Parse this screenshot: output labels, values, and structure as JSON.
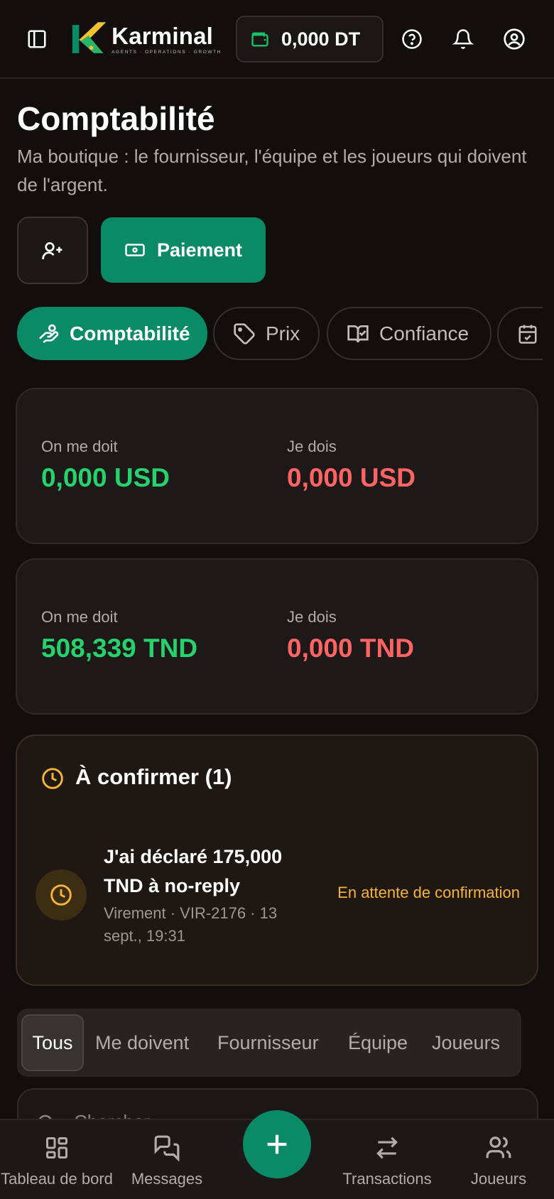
{
  "header": {
    "brand_name": "Karminal",
    "brand_tagline": "AGENTS · OPERATIONS · GROWTH",
    "wallet_amount": "0,000 DT"
  },
  "page": {
    "title": "Comptabilité",
    "subtitle": "Ma boutique : le fournisseur, l'équipe et les joueurs qui doivent de l'argent."
  },
  "actions": {
    "payment_label": "Paiement"
  },
  "tabs": [
    {
      "label": "Comptabilité",
      "icon": "hand-coins-icon",
      "active": true
    },
    {
      "label": "Prix",
      "icon": "tag-icon",
      "active": false
    },
    {
      "label": "Confiance",
      "icon": "book-check-icon",
      "active": false
    },
    {
      "label": "",
      "icon": "calendar-check-icon",
      "active": false
    }
  ],
  "balances": [
    {
      "owed_to_me_label": "On me doit",
      "owed_to_me": "0,000 USD",
      "i_owe_label": "Je dois",
      "i_owe": "0,000 USD"
    },
    {
      "owed_to_me_label": "On me doit",
      "owed_to_me": "508,339 TND",
      "i_owe_label": "Je dois",
      "i_owe": "0,000 TND"
    }
  ],
  "to_confirm": {
    "title": "À confirmer (1)",
    "item_text": "J'ai déclaré 175,000 TND à no-reply",
    "item_meta": "Virement · VIR-2176 · 13 sept., 19:31",
    "status": "En attente de confirmation"
  },
  "filters": [
    "Tous",
    "Me doivent",
    "Fournisseur",
    "Équipe",
    "Joueurs"
  ],
  "search": {
    "placeholder": "Chercher..."
  },
  "bottom_nav": [
    {
      "label": "Tableau de bord",
      "icon": "dashboard-icon"
    },
    {
      "label": "Messages",
      "icon": "messages-icon"
    },
    {
      "label": "Transactions",
      "icon": "transfer-icon"
    },
    {
      "label": "Joueurs",
      "icon": "users-icon"
    }
  ],
  "colors": {
    "accent": "#0b8a66",
    "positive": "#27d16b",
    "negative": "#ff6464",
    "warning": "#f4b33b",
    "background": "#120e0d"
  }
}
